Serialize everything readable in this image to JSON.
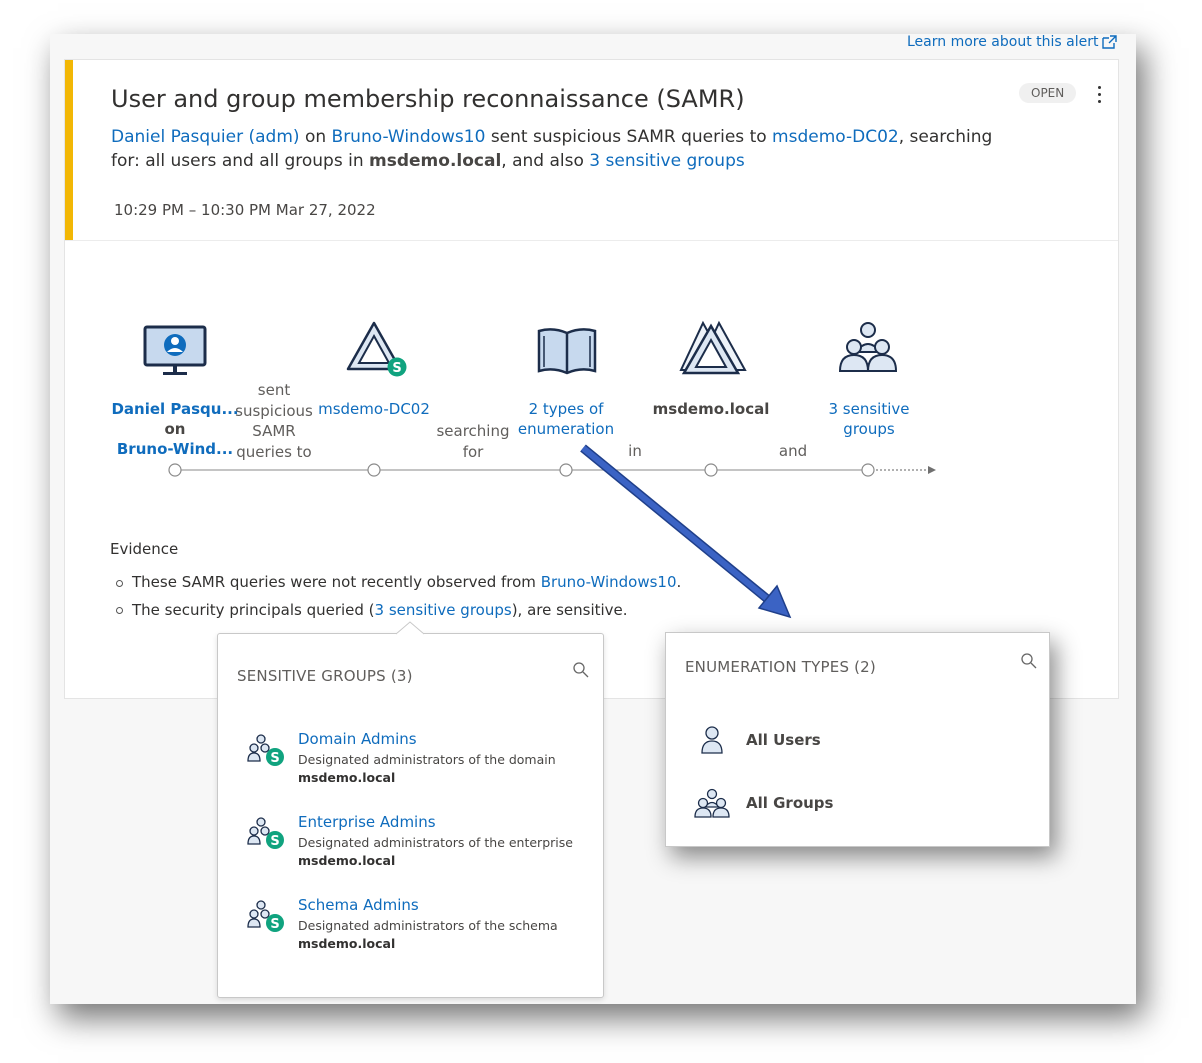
{
  "header": {
    "learn_more": "Learn more about this alert"
  },
  "alert": {
    "title": "User and group membership reconnaissance (SAMR)",
    "status": "OPEN",
    "summary": {
      "actor": "Daniel Pasquier (adm)",
      "on": "on",
      "machine": "Bruno-Windows10",
      "verb": "sent suspicious SAMR queries to",
      "target": "msdemo-DC02",
      "mid": ", searching for: all users and all groups in",
      "domain": "msdemo.local",
      "also": ", and also",
      "sensitive": "3 sensitive groups"
    },
    "time": "10:29 PM – 10:30 PM Mar 27, 2022",
    "colors": {
      "accent": "#f2b705",
      "link": "#0f6cbd",
      "sensitive_badge": "#10a37f"
    }
  },
  "flow": {
    "node1_line1": "Daniel Pasqu...",
    "node1_line2": "on",
    "node1_line3": "Bruno-Wind...",
    "conn1_line1": "sent",
    "conn1_line2": "suspicious",
    "conn1_line3": "SAMR",
    "conn1_line4": "queries to",
    "node2": "msdemo-DC02",
    "conn2_line1": "searching",
    "conn2_line2": "for",
    "node3_line1": "2 types of",
    "node3_line2": "enumeration",
    "conn3": "in",
    "node4": "msdemo.local",
    "conn4": "and",
    "node5_line1": "3 sensitive",
    "node5_line2": "groups"
  },
  "evidence": {
    "title": "Evidence",
    "item1_pre": "These SAMR queries were not recently observed from",
    "item1_link": "Bruno-Windows10",
    "item1_post": ".",
    "item2_pre": "The security principals queried (",
    "item2_link": "3 sensitive groups",
    "item2_post": "), are sensitive."
  },
  "sensitive_popup": {
    "title": "SENSITIVE GROUPS (3)",
    "groups": [
      {
        "name": "Domain Admins",
        "description": "Designated administrators of the domain",
        "domain": "msdemo.local"
      },
      {
        "name": "Enterprise Admins",
        "description": "Designated administrators of the enterprise",
        "domain": "msdemo.local"
      },
      {
        "name": "Schema Admins",
        "description": "Designated administrators of the schema",
        "domain": "msdemo.local"
      }
    ]
  },
  "enum_popup": {
    "title": "ENUMERATION TYPES (2)",
    "items": [
      {
        "label": "All Users",
        "icon": "user-icon"
      },
      {
        "label": "All Groups",
        "icon": "group-icon"
      }
    ]
  }
}
